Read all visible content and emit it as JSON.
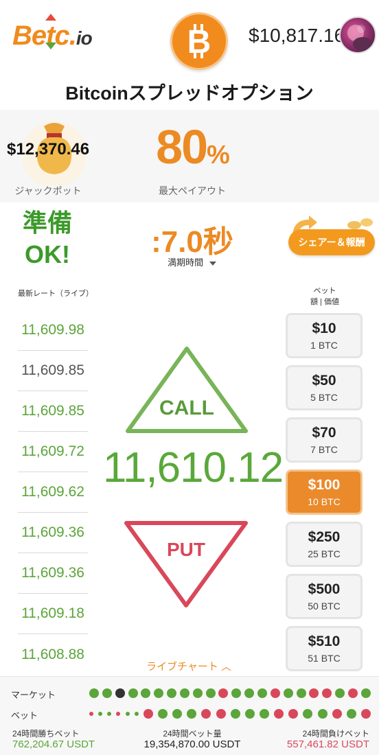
{
  "header": {
    "logo_main": "Betc.",
    "logo_suffix": "io",
    "balance": "$10,817.16"
  },
  "title": "Bitcoinスプレッドオプション",
  "stats": {
    "jackpot_value": "$12,370.46",
    "jackpot_label": "ジャックポット",
    "payout_value": "80",
    "payout_unit": "%",
    "payout_label": "最大ペイアウト"
  },
  "status": {
    "ready_line1": "準備",
    "ready_line2": "OK!",
    "timer": ":7.0秒",
    "expiry_label": "満期時間",
    "share_label": "シェアー＆報酬"
  },
  "rates": {
    "header": "最新レート（ライブ）",
    "items": [
      {
        "value": "11,609.98",
        "trend": "up"
      },
      {
        "value": "11,609.85",
        "trend": "flat"
      },
      {
        "value": "11,609.85",
        "trend": "up"
      },
      {
        "value": "11,609.72",
        "trend": "up"
      },
      {
        "value": "11,609.62",
        "trend": "up"
      },
      {
        "value": "11,609.36",
        "trend": "up"
      },
      {
        "value": "11,609.36",
        "trend": "up"
      },
      {
        "value": "11,609.18",
        "trend": "up"
      },
      {
        "value": "11,608.88",
        "trend": "up"
      }
    ]
  },
  "bets": {
    "header_line1": "ベット",
    "header_line2": "額 | 価値",
    "items": [
      {
        "amount": "$10",
        "btc": "1 BTC"
      },
      {
        "amount": "$50",
        "btc": "5 BTC"
      },
      {
        "amount": "$70",
        "btc": "7 BTC"
      },
      {
        "amount": "$100",
        "btc": "10 BTC",
        "active": true
      },
      {
        "amount": "$250",
        "btc": "25 BTC"
      },
      {
        "amount": "$500",
        "btc": "50 BTC"
      },
      {
        "amount": "$510",
        "btc": "51 BTC"
      }
    ]
  },
  "trade": {
    "call_label": "CALL",
    "put_label": "PUT",
    "current_price": "11,610.12"
  },
  "live_chart_label": "ライブチャート ︿",
  "footer": {
    "market_label": "マーケット",
    "bet_label": "ベット",
    "market_dots": [
      "green",
      "green",
      "dark",
      "green",
      "green",
      "green",
      "green",
      "green",
      "green",
      "green",
      "red",
      "green",
      "green",
      "green",
      "red",
      "green",
      "green",
      "red",
      "red",
      "green",
      "red",
      "green"
    ],
    "bet_dots": [
      "red-s",
      "green-s",
      "green-s",
      "red-s",
      "green-s",
      "green-s",
      "red",
      "green",
      "green",
      "green",
      "red",
      "red",
      "green",
      "green",
      "green",
      "red",
      "red",
      "green",
      "green",
      "red",
      "green",
      "red"
    ],
    "win_label": "24時間勝ちベット",
    "win_value": "762,204.67 USDT",
    "volume_label": "24時間ベット量",
    "volume_value": "19,354,870.00 USDT",
    "loss_label": "24時間負けベット",
    "loss_value": "557,461.82 USDT"
  },
  "colors": {
    "accent": "#ec8a23",
    "up": "#5ba53a",
    "down": "#d9485a",
    "dark": "#333333"
  }
}
